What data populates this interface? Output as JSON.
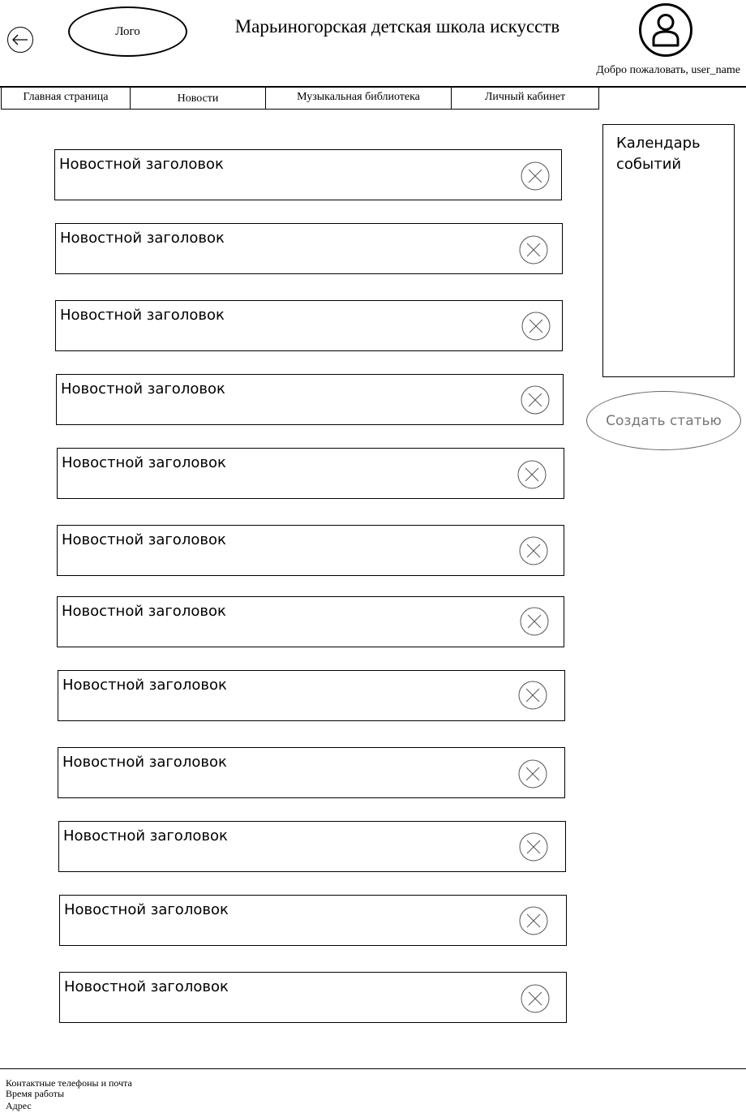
{
  "header": {
    "logo_label": "Лого",
    "site_title": "Марьиногорская детская школа искусств",
    "welcome_text": "Добро пожаловать, user_name"
  },
  "nav": {
    "items": [
      {
        "label": "Главная страница"
      },
      {
        "label": "Новости"
      },
      {
        "label": "Музыкальная библиотека"
      },
      {
        "label": "Личный кабинет"
      }
    ]
  },
  "news": {
    "items": [
      {
        "title": "Новостной заголовок"
      },
      {
        "title": "Новостной заголовок"
      },
      {
        "title": "Новостной заголовок"
      },
      {
        "title": "Новостной заголовок"
      },
      {
        "title": "Новостной заголовок"
      },
      {
        "title": "Новостной заголовок"
      },
      {
        "title": "Новостной заголовок"
      },
      {
        "title": "Новостной заголовок"
      },
      {
        "title": "Новостной заголовок"
      },
      {
        "title": "Новостной заголовок"
      },
      {
        "title": "Новостной заголовок"
      },
      {
        "title": "Новостной заголовок"
      }
    ]
  },
  "sidebar": {
    "calendar_title": "Календарь событий",
    "create_article_label": "Создать статью"
  },
  "footer": {
    "contacts": "Контактные телефоны и почта",
    "hours": "Время работы",
    "address": "Адрес"
  },
  "icons": {
    "back": "arrow-left-icon",
    "avatar": "user-icon",
    "delete": "close-circle-icon"
  }
}
